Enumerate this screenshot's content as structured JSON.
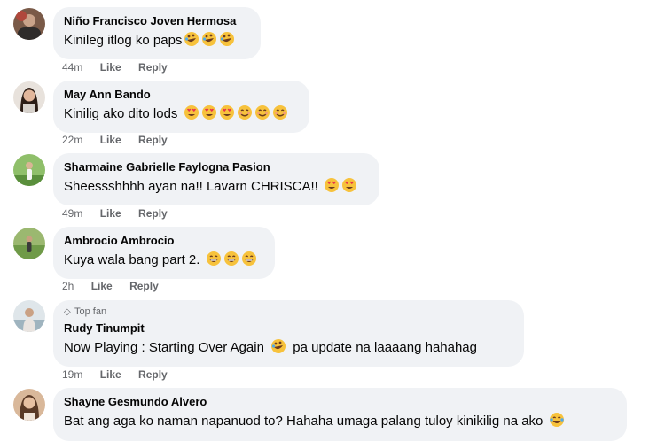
{
  "comments": [
    {
      "author": "Niño Francisco Joven Hermosa",
      "text": "Kinileg itlog ko paps",
      "emojis": [
        "rofl-emoji",
        "rofl-emoji",
        "rofl-emoji"
      ],
      "time": "44m",
      "like_label": "Like",
      "reply_label": "Reply"
    },
    {
      "author": "May Ann Bando",
      "text": "Kinilig ako dito lods",
      "emojis": [
        "heart-eyes-emoji",
        "heart-eyes-emoji",
        "heart-eyes-emoji",
        "smile-emoji",
        "smile-emoji",
        "smile-emoji"
      ],
      "time": "22m",
      "like_label": "Like",
      "reply_label": "Reply"
    },
    {
      "author": "Sharmaine Gabrielle Faylogna Pasion",
      "text": "Sheessshhhh ayan na!! Lavarn CHRISCA!! ",
      "emojis": [
        "heart-eyes-emoji",
        "heart-eyes-emoji"
      ],
      "time": "49m",
      "like_label": "Like",
      "reply_label": "Reply"
    },
    {
      "author": "Ambrocio Ambrocio",
      "text": "Kuya wala bang part 2.",
      "emojis": [
        "grin-emoji",
        "grin-emoji",
        "grin-emoji"
      ],
      "time": "2h",
      "like_label": "Like",
      "reply_label": "Reply"
    },
    {
      "badge": "Top fan",
      "author": "Rudy Tinumpit",
      "text_before": "Now Playing : Starting Over Again ",
      "text_after": " pa update na laaaang hahahag",
      "time": "19m",
      "like_label": "Like",
      "reply_label": "Reply"
    },
    {
      "author": "Shayne Gesmundo Alvero",
      "text": "Bat ang aga ko naman napanuod to? Hahaha umaga palang tuloy kinikilig na ako ",
      "emojis": [
        "laugh-tears-emoji"
      ]
    }
  ]
}
